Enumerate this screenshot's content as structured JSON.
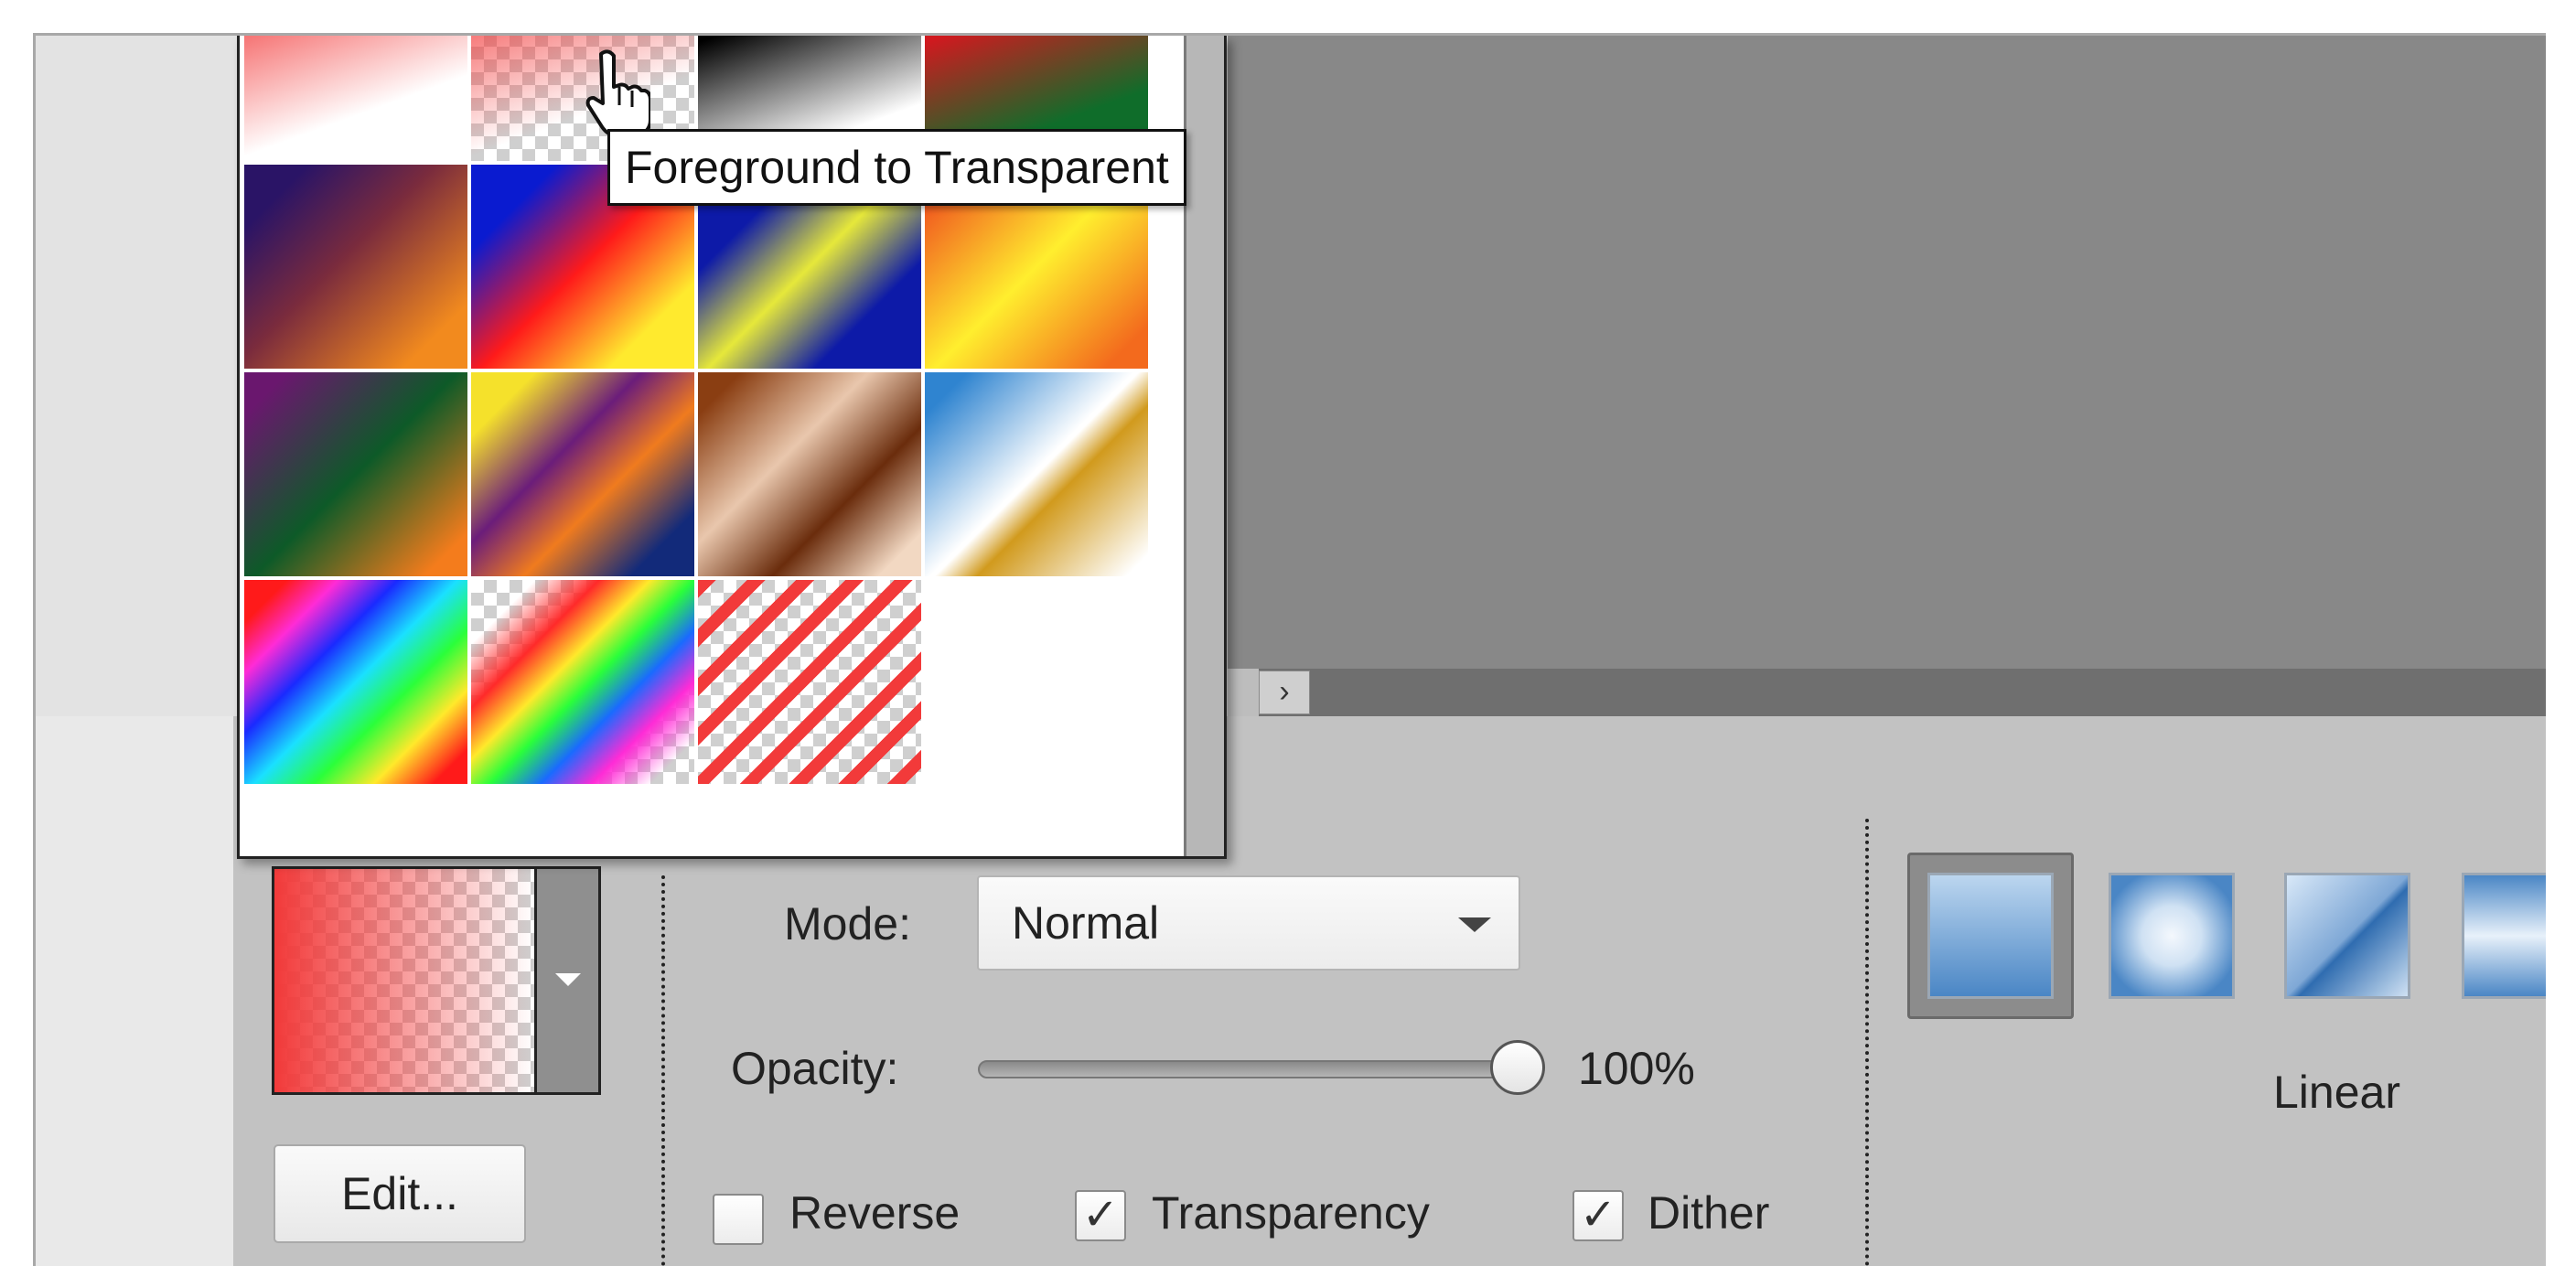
{
  "tooltip": "Foreground to Transparent",
  "picker": {
    "presets": [
      "Foreground to Background",
      "Foreground to Transparent",
      "Black, White",
      "Red, Green",
      "Violet, Orange",
      "Blue, Red, Yellow",
      "Blue, Yellow, Blue",
      "Orange, Yellow, Orange",
      "Violet, Green, Orange",
      "Yellow, Violet, Orange, Blue",
      "Copper",
      "Chrome",
      "Spectrum",
      "Transparent Rainbow",
      "Transparent Stripes"
    ]
  },
  "edit_button": "Edit...",
  "mode": {
    "label": "Mode:",
    "value": "Normal"
  },
  "opacity": {
    "label": "Opacity:",
    "value": "100%",
    "fraction": 1.0
  },
  "options": {
    "reverse": {
      "label": "Reverse",
      "checked": false
    },
    "transparency": {
      "label": "Transparency",
      "checked": true
    },
    "dither": {
      "label": "Dither",
      "checked": true
    }
  },
  "gradient_types": {
    "selected_label": "Linear",
    "types": [
      "linear",
      "radial",
      "angle",
      "reflected"
    ]
  },
  "colors": {
    "foreground": "#f23a3a",
    "panel_bg": "#c2c2c2",
    "canvas_bg": "#888888"
  }
}
